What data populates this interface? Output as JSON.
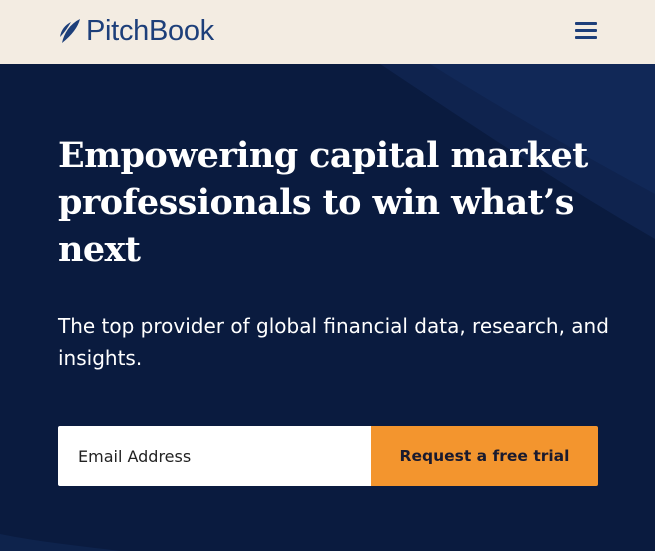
{
  "header": {
    "logo_text": "PitchBook",
    "menu_icon": "hamburger-menu-icon"
  },
  "hero": {
    "headline": "Empowering capital market professionals to win what’s next",
    "subheadline": "The top provider of global financial data, research, and insights.",
    "email_placeholder": "Email Address",
    "email_value": "",
    "cta_label": "Request a free trial"
  },
  "colors": {
    "header_bg": "#f3ece2",
    "brand_blue": "#1d3f7a",
    "hero_bg": "#0a1b3f",
    "cta_orange": "#f3952e",
    "text_white": "#ffffff"
  }
}
